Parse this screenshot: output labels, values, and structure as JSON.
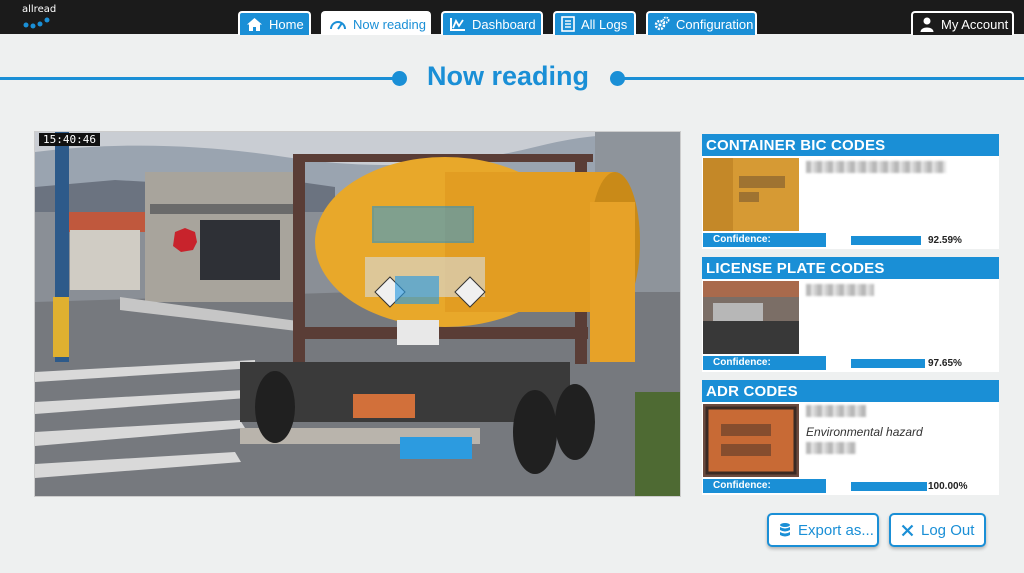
{
  "app": {
    "logo_text": "allread"
  },
  "nav": {
    "tabs": [
      {
        "label": "Home",
        "icon": "home-icon"
      },
      {
        "label": "Now reading",
        "icon": "speedometer-icon",
        "active": true
      },
      {
        "label": "Dashboard",
        "icon": "chart-icon"
      },
      {
        "label": "All Logs",
        "icon": "list-icon"
      },
      {
        "label": "Configuration",
        "icon": "gears-icon"
      }
    ],
    "account_label": "My Account"
  },
  "page": {
    "title": "Now reading"
  },
  "camera": {
    "timestamp": "15:40:46"
  },
  "panels": [
    {
      "title": "CONTAINER BIC CODES",
      "description": "",
      "confidence_label": "Confidence:",
      "confidence_value": "92.59%",
      "confidence": 0.9259
    },
    {
      "title": "LICENSE PLATE CODES",
      "description": "",
      "confidence_label": "Confidence:",
      "confidence_value": "97.65%",
      "confidence": 0.9765
    },
    {
      "title": "ADR CODES",
      "description": "Environmental hazard",
      "confidence_label": "Confidence:",
      "confidence_value": "100.00%",
      "confidence": 1.0
    }
  ],
  "actions": {
    "export_label": "Export as...",
    "logout_label": "Log Out"
  },
  "colors": {
    "accent": "#1a8fd6",
    "topbar": "#1b1b1b",
    "background": "#eef0f0",
    "tank": "#e8a82a"
  }
}
